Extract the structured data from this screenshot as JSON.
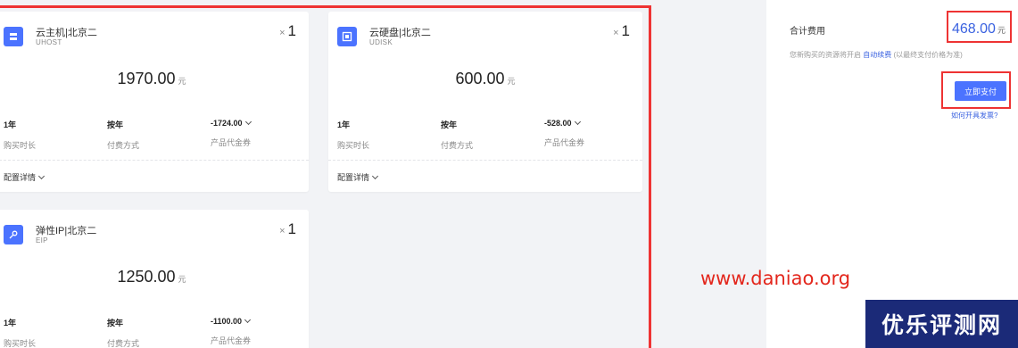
{
  "products": [
    {
      "title": "云主机|北京二",
      "code": "UHOST",
      "icon": "server-icon",
      "qty_prefix": "×",
      "qty": "1",
      "price": "1970.00",
      "unit": "元",
      "duration": "1年",
      "duration_label": "购买时长",
      "payment": "按年",
      "payment_label": "付费方式",
      "coupon": "-1724.00",
      "coupon_label": "产品代金券",
      "config_label": "配置详情"
    },
    {
      "title": "云硬盘|北京二",
      "code": "UDISK",
      "icon": "disk-icon",
      "qty_prefix": "×",
      "qty": "1",
      "price": "600.00",
      "unit": "元",
      "duration": "1年",
      "duration_label": "购买时长",
      "payment": "按年",
      "payment_label": "付费方式",
      "coupon": "-528.00",
      "coupon_label": "产品代金券",
      "config_label": "配置详情"
    },
    {
      "title": "弹性IP|北京二",
      "code": "EIP",
      "icon": "ip-icon",
      "qty_prefix": "×",
      "qty": "1",
      "price": "1250.00",
      "unit": "元",
      "duration": "1年",
      "duration_label": "购买时长",
      "payment": "按年",
      "payment_label": "付费方式",
      "coupon": "-1100.00",
      "coupon_label": "产品代金券"
    }
  ],
  "summary": {
    "total_label": "合计费用",
    "total": "468.00",
    "unit": "元",
    "notice_prefix": "您新购买的资源将开启",
    "notice_link": "自动续费",
    "notice_suffix": "(以最终支付价格为准)",
    "pay_button": "立即支付",
    "invoice_link": "如何开具发票?"
  },
  "watermark": {
    "url": "www.daniao.org",
    "logo": "优乐评测网"
  },
  "colors": {
    "accent": "#4b73ff",
    "highlight": "#ee3333",
    "link": "#3a62e0"
  }
}
